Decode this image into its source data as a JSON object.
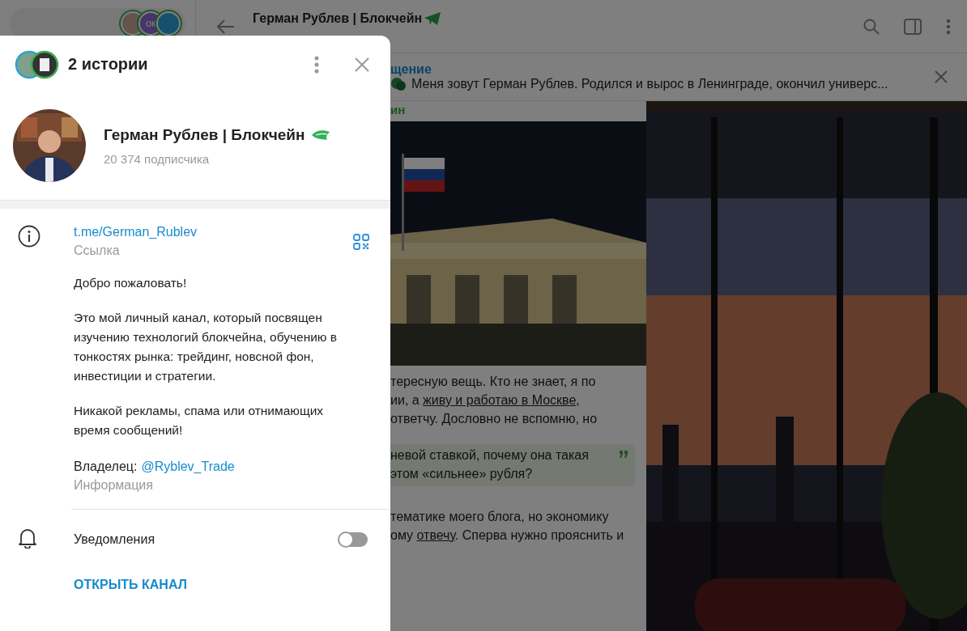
{
  "sidebar": {
    "story_avatars": [
      {
        "kind": "picture"
      },
      {
        "kind": "initials",
        "initials": "ок"
      },
      {
        "kind": "telegram"
      }
    ]
  },
  "header": {
    "title": "Герман Рублев | Блокчейн"
  },
  "pinned": {
    "title": "щение",
    "text": "Меня зовут Герман Рублев. Родился и вырос в Ленинграде, окончил универс..."
  },
  "message": {
    "author": "ин",
    "paragraphs": [
      [
        [
          {
            "kind": "text",
            "text": "тересную вещь. Кто не знает, я по"
          }
        ],
        [
          {
            "kind": "text",
            "text": "ии, а "
          },
          {
            "kind": "link",
            "text": "живу и работаю в Москве"
          },
          {
            "kind": "text",
            "text": ","
          }
        ],
        [
          {
            "kind": "text",
            "text": "ответчу. Дословно не вспомню, но"
          }
        ]
      ],
      [
        [
          {
            "kind": "text",
            "text": "тематике моего блога, но экономику"
          }
        ],
        [
          {
            "kind": "text",
            "text": "ому "
          },
          {
            "kind": "link",
            "text": "отвечу"
          },
          {
            "kind": "text",
            "text": ". Сперва нужно прояснить и"
          }
        ]
      ]
    ],
    "quote": [
      "невой ставкой, почему она такая",
      "этом «сильнее» рубля?"
    ]
  },
  "modal": {
    "stories_title": "2 истории",
    "channel_name": "Герман Рублев | Блокчейн",
    "subscribers": "20 374 подписчика",
    "link": "t.me/German_Rublev",
    "link_label": "Ссылка",
    "description": [
      "Добро пожаловать!",
      "Это мой личный канал, который посвящен изучению технологий блокчейна, обучению в тонкостях рынка: трейдинг, новсной фон, инвестиции и стратегии.",
      "Никакой рекламы, спама или отнимающих время сообщений!"
    ],
    "owner_label": "Владелец:",
    "owner_link": "@Ryblev_Trade",
    "info_label": "Информация",
    "notifications": {
      "label": "Уведомления",
      "on": false
    },
    "open_button": "ОТКРЫТЬ КАНАЛ"
  }
}
